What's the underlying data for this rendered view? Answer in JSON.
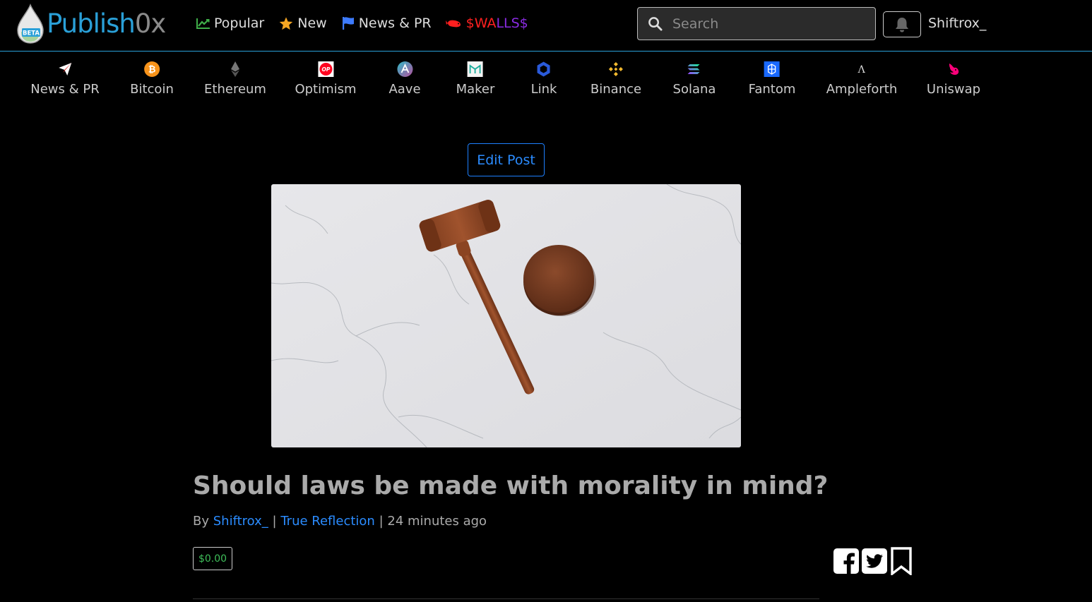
{
  "brand": {
    "name_part1": "Publish",
    "name_part2": "0x",
    "badge": "BETA"
  },
  "topnav": {
    "popular": "Popular",
    "new": "New",
    "news_pr": "News & PR",
    "walls_part1": "$WA",
    "walls_part2": "LLS$"
  },
  "search": {
    "placeholder": "Search"
  },
  "user": {
    "name": "Shiftrox_"
  },
  "categories": [
    {
      "label": "News & PR",
      "icon": "paper-plane-icon",
      "color": "#e03030"
    },
    {
      "label": "Bitcoin",
      "icon": "bitcoin-icon",
      "color": "#f7931a"
    },
    {
      "label": "Ethereum",
      "icon": "ethereum-icon",
      "color": "#888888"
    },
    {
      "label": "Optimism",
      "icon": "optimism-icon",
      "color": "#ff0420",
      "glyph": "OP"
    },
    {
      "label": "Aave",
      "icon": "aave-icon",
      "color": "#8a63d2"
    },
    {
      "label": "Maker",
      "icon": "maker-icon",
      "color": "#1aab9b"
    },
    {
      "label": "Link",
      "icon": "chainlink-icon",
      "color": "#2a5ada"
    },
    {
      "label": "Binance",
      "icon": "binance-icon",
      "color": "#f3ba2f"
    },
    {
      "label": "Solana",
      "icon": "solana-icon",
      "color": "#14f195"
    },
    {
      "label": "Fantom",
      "icon": "fantom-icon",
      "color": "#1969ff"
    },
    {
      "label": "Ampleforth",
      "icon": "ampleforth-icon",
      "color": "#dddddd",
      "glyph": "Λ"
    },
    {
      "label": "Uniswap",
      "icon": "uniswap-icon",
      "color": "#ff007a"
    }
  ],
  "article": {
    "edit_label": "Edit Post",
    "title": "Should laws be made with morality in mind?",
    "by": "By",
    "author": "Shiftrox_",
    "sep1": "|",
    "blog": "True Reflection",
    "sep2": "|",
    "time": "24 minutes ago",
    "tip_amount": "$0.00"
  },
  "colors": {
    "accent": "#2aa0d8",
    "link": "#2b8cff",
    "tip": "#3fbf5a"
  }
}
